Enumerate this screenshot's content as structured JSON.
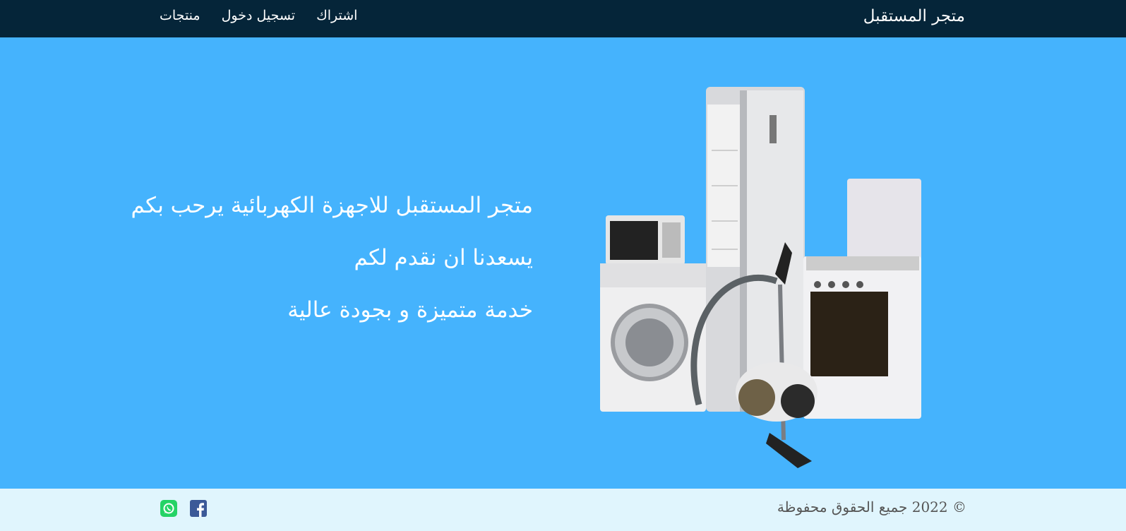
{
  "navbar": {
    "brand": "متجر المستقبل",
    "links": [
      {
        "label": "اشتراك"
      },
      {
        "label": "تسجيل دخول"
      },
      {
        "label": "منتجات"
      }
    ]
  },
  "hero": {
    "lines": [
      "متجر المستقبل للاجهزة الكهربائية يرحب بكم",
      "يسعدنا ان نقدم لكم",
      "خدمة متميزة و بجودة عالية"
    ],
    "image_alt": "appliances"
  },
  "footer": {
    "copyright": "© 2022 جميع الحقوق محفوظة",
    "social": [
      {
        "icon": "whatsapp-icon",
        "color": "#25d366"
      },
      {
        "icon": "facebook-icon",
        "color": "#3b5998"
      }
    ]
  },
  "colors": {
    "navbar_bg": "#052539",
    "hero_bg": "#45b3fd",
    "footer_bg": "#e0f5fd"
  }
}
